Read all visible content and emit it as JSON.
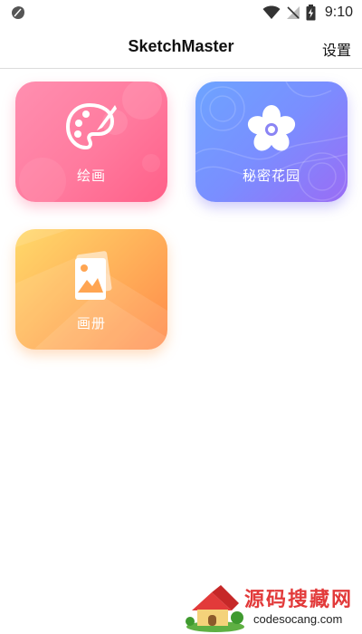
{
  "status_bar": {
    "time": "9:10"
  },
  "app_bar": {
    "title": "SketchMaster",
    "settings_label": "设置"
  },
  "tiles": [
    {
      "label": "绘画",
      "icon": "palette-icon",
      "color": "#ff7a9e"
    },
    {
      "label": "秘密花园",
      "icon": "flower-icon",
      "color": "#7a8eff"
    },
    {
      "label": "画册",
      "icon": "photo-album-icon",
      "color": "#ffb25a"
    }
  ],
  "watermark": {
    "title": "源码搜藏网",
    "url": "codesocang.com"
  }
}
